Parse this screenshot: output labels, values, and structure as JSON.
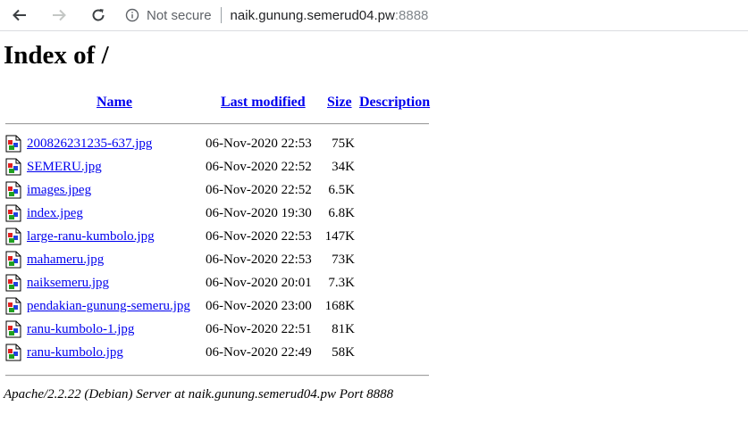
{
  "browser": {
    "security_label": "Not secure",
    "url_host": "naik.gunung.semerud04.pw",
    "url_port": ":8888"
  },
  "page": {
    "title": "Index of /",
    "columns": {
      "name": "Name",
      "last_modified": "Last modified",
      "size": "Size",
      "description": "Description"
    },
    "files": [
      {
        "name": "200826231235-637.jpg",
        "modified": "06-Nov-2020 22:53",
        "size": "75K"
      },
      {
        "name": "SEMERU.jpg",
        "modified": "06-Nov-2020 22:52",
        "size": "34K"
      },
      {
        "name": "images.jpeg",
        "modified": "06-Nov-2020 22:52",
        "size": "6.5K"
      },
      {
        "name": "index.jpeg",
        "modified": "06-Nov-2020 19:30",
        "size": "6.8K"
      },
      {
        "name": "large-ranu-kumbolo.jpg",
        "modified": "06-Nov-2020 22:53",
        "size": "147K"
      },
      {
        "name": "mahameru.jpg",
        "modified": "06-Nov-2020 22:53",
        "size": "73K"
      },
      {
        "name": "naiksemeru.jpg",
        "modified": "06-Nov-2020 20:01",
        "size": "7.3K"
      },
      {
        "name": "pendakian-gunung-semeru.jpg",
        "modified": "06-Nov-2020 23:00",
        "size": "168K"
      },
      {
        "name": "ranu-kumbolo-1.jpg",
        "modified": "06-Nov-2020 22:51",
        "size": "81K"
      },
      {
        "name": "ranu-kumbolo.jpg",
        "modified": "06-Nov-2020 22:49",
        "size": "58K"
      }
    ],
    "footer": "Apache/2.2.22 (Debian) Server at naik.gunung.semerud04.pw Port 8888"
  }
}
